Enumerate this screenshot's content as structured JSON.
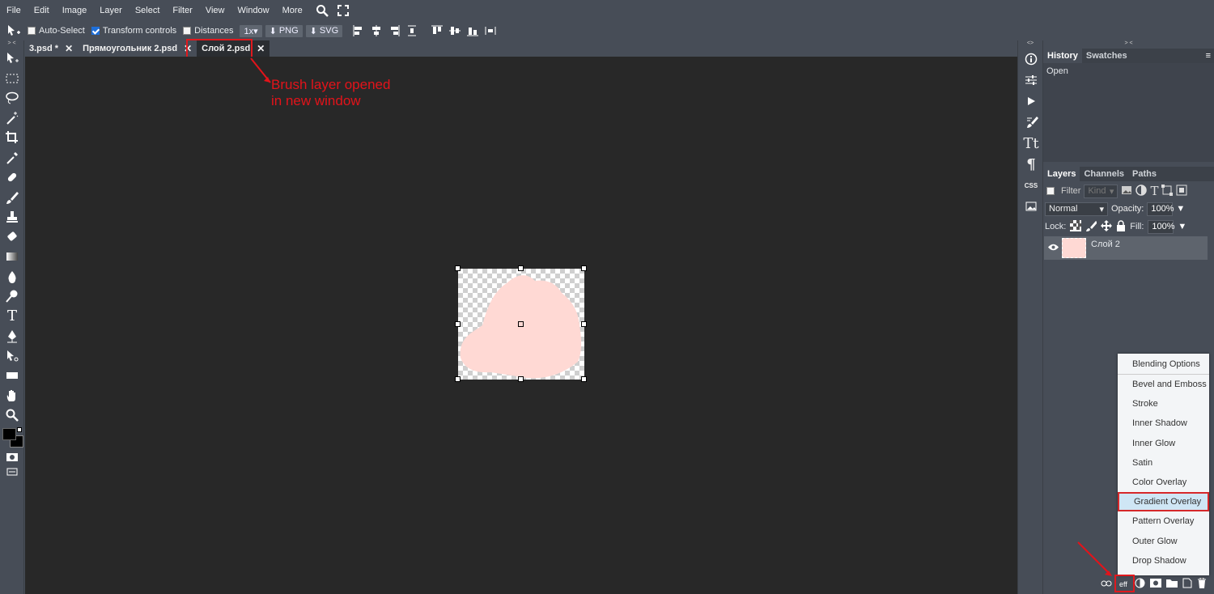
{
  "menu": [
    "File",
    "Edit",
    "Image",
    "Layer",
    "Select",
    "Filter",
    "View",
    "Window",
    "More"
  ],
  "options": {
    "auto_select": "Auto-Select",
    "transform_controls": "Transform controls",
    "distances": "Distances",
    "scale": "1x▾",
    "png": "PNG",
    "svg": "SVG"
  },
  "tabs": [
    {
      "label": "3.psd *"
    },
    {
      "label": "Прямоугольник 2.psd"
    },
    {
      "label": "Слой 2.psd"
    }
  ],
  "annotation": {
    "line1": "Brush layer opened",
    "line2": "in new window"
  },
  "history_panel": {
    "tabs": [
      "History",
      "Swatches"
    ],
    "items": [
      "Open"
    ]
  },
  "layers_panel": {
    "tabs": [
      "Layers",
      "Channels",
      "Paths"
    ],
    "filter_label": "Filter",
    "kind_placeholder": "Kind",
    "blend_mode": "Normal",
    "opacity_label": "Opacity:",
    "opacity_value": "100%",
    "lock_label": "Lock:",
    "fill_label": "Fill:",
    "fill_value": "100%",
    "layer_name": "Слой 2"
  },
  "mid_panel": {
    "css_label": "CSS",
    "collapse": "<>",
    "collapse_right": "> <",
    "collapse_left": "> <"
  },
  "effects_menu": [
    "Blending Options",
    "Bevel and Emboss",
    "Stroke",
    "Inner Shadow",
    "Inner Glow",
    "Satin",
    "Color Overlay",
    "Gradient Overlay",
    "Pattern Overlay",
    "Outer Glow",
    "Drop Shadow"
  ],
  "bottom_bar": {
    "eff_label": "eff"
  },
  "colors": {
    "annotation": "#e3131a",
    "layer_fill": "#ffd9d4",
    "selected_menu": "#cfe6f5"
  }
}
